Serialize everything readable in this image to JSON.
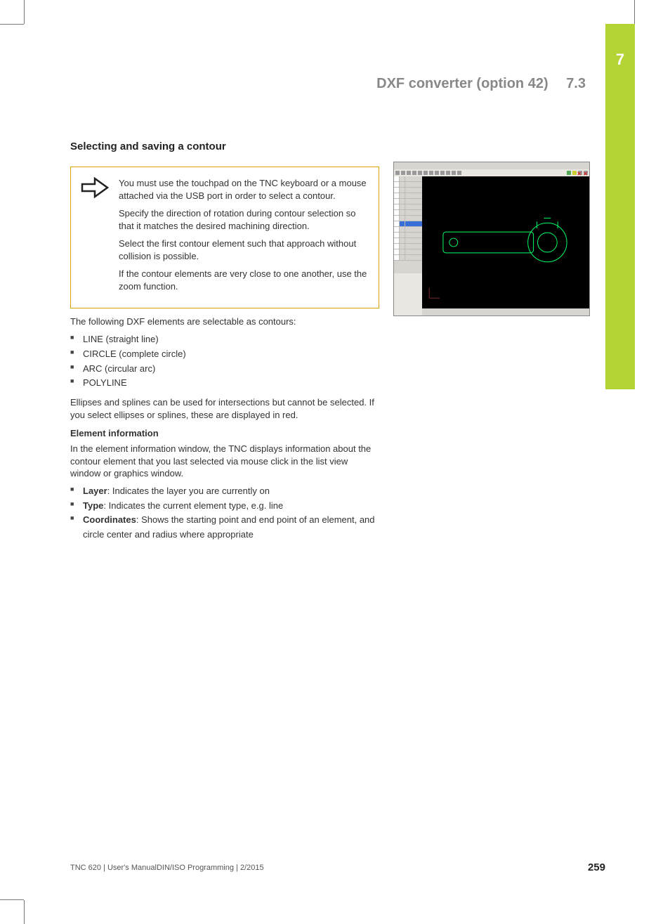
{
  "chapter": {
    "number": "7"
  },
  "header": {
    "title": "DXF converter (option 42)",
    "section": "7.3"
  },
  "section_heading": "Selecting and saving a contour",
  "note": {
    "p1": "You must use the touchpad on the TNC keyboard or a mouse attached via the USB port in order to select a contour.",
    "p2": "Specify the direction of rotation during contour selection so that it matches the desired machining direction.",
    "p3": "Select the first contour element such that approach without collision is possible.",
    "p4": "If the contour elements are very close to one another, use the zoom function."
  },
  "para_following": "The following DXF elements are selectable as contours:",
  "dxf_items": [
    "LINE (straight line)",
    "CIRCLE (complete circle)",
    "ARC (circular arc)",
    "POLYLINE"
  ],
  "para_ellipses": "Ellipses and splines can be used for intersections but cannot be selected. If you select ellipses or splines, these are displayed in red.",
  "elem_info_heading": "Element information",
  "para_elem_info": "In the element information window, the TNC displays information about the contour element that you last selected via mouse click in the list view window or graphics window.",
  "elem_info_items": {
    "layer": {
      "label": "Layer",
      "text": ": Indicates the layer you are currently on"
    },
    "type": {
      "label": "Type",
      "text": ": Indicates the current element type, e.g. line"
    },
    "coords": {
      "label": "Coordinates",
      "text": ": Shows the starting point and end point of an element, and circle center and radius where appropriate"
    }
  },
  "footer": {
    "left": "TNC 620 | User's ManualDIN/ISO Programming | 2/2015",
    "page": "259"
  }
}
